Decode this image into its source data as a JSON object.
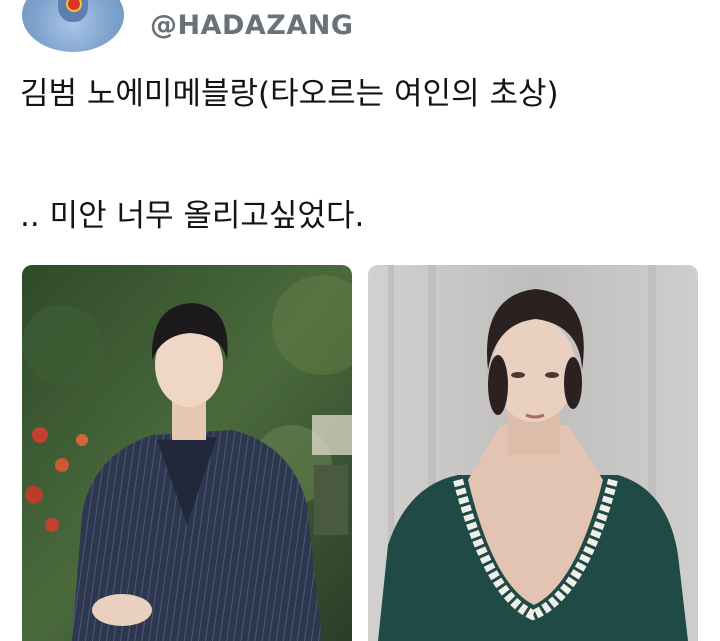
{
  "tweet": {
    "handle": "@HADAZANG",
    "line1": "김범 노에미메블랑(타오르는 여인의 초상)",
    "line2": ".. 미안 너무 올리고싶었다."
  },
  "media": [
    {
      "alt": "man-in-pinstripe-suit-photo"
    },
    {
      "alt": "woman-in-green-period-dress-photo"
    }
  ],
  "colors": {
    "handle": "#6b7177",
    "text": "#141414",
    "suit": "#2f3a52",
    "dress": "#1f4a45",
    "curtain": "#c9c8c7"
  }
}
